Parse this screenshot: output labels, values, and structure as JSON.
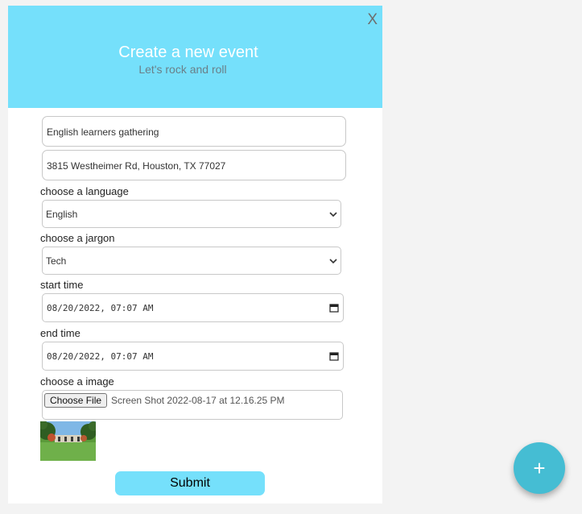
{
  "modal": {
    "close_label": "X",
    "title": "Create a new event",
    "subtitle": "Let's rock and roll"
  },
  "form": {
    "event_name": "English learners gathering",
    "address": "3815 Westheimer Rd, Houston, TX 77027",
    "language_label": "choose a language",
    "language_value": "English",
    "jargon_label": "choose a jargon",
    "jargon_value": "Tech",
    "start_label": "start time",
    "start_value": "08/20/2022, 07:07 AM",
    "end_label": "end time",
    "end_value": "08/20/2022, 07:07 AM",
    "image_label": "choose a image",
    "file_button": "Choose File",
    "file_name": "Screen Shot 2022-08-17 at 12.16.25 PM",
    "submit_label": "Submit"
  },
  "fab": {
    "label": "+"
  },
  "colors": {
    "accent": "#75e0fb",
    "fab": "#45bdd3"
  }
}
